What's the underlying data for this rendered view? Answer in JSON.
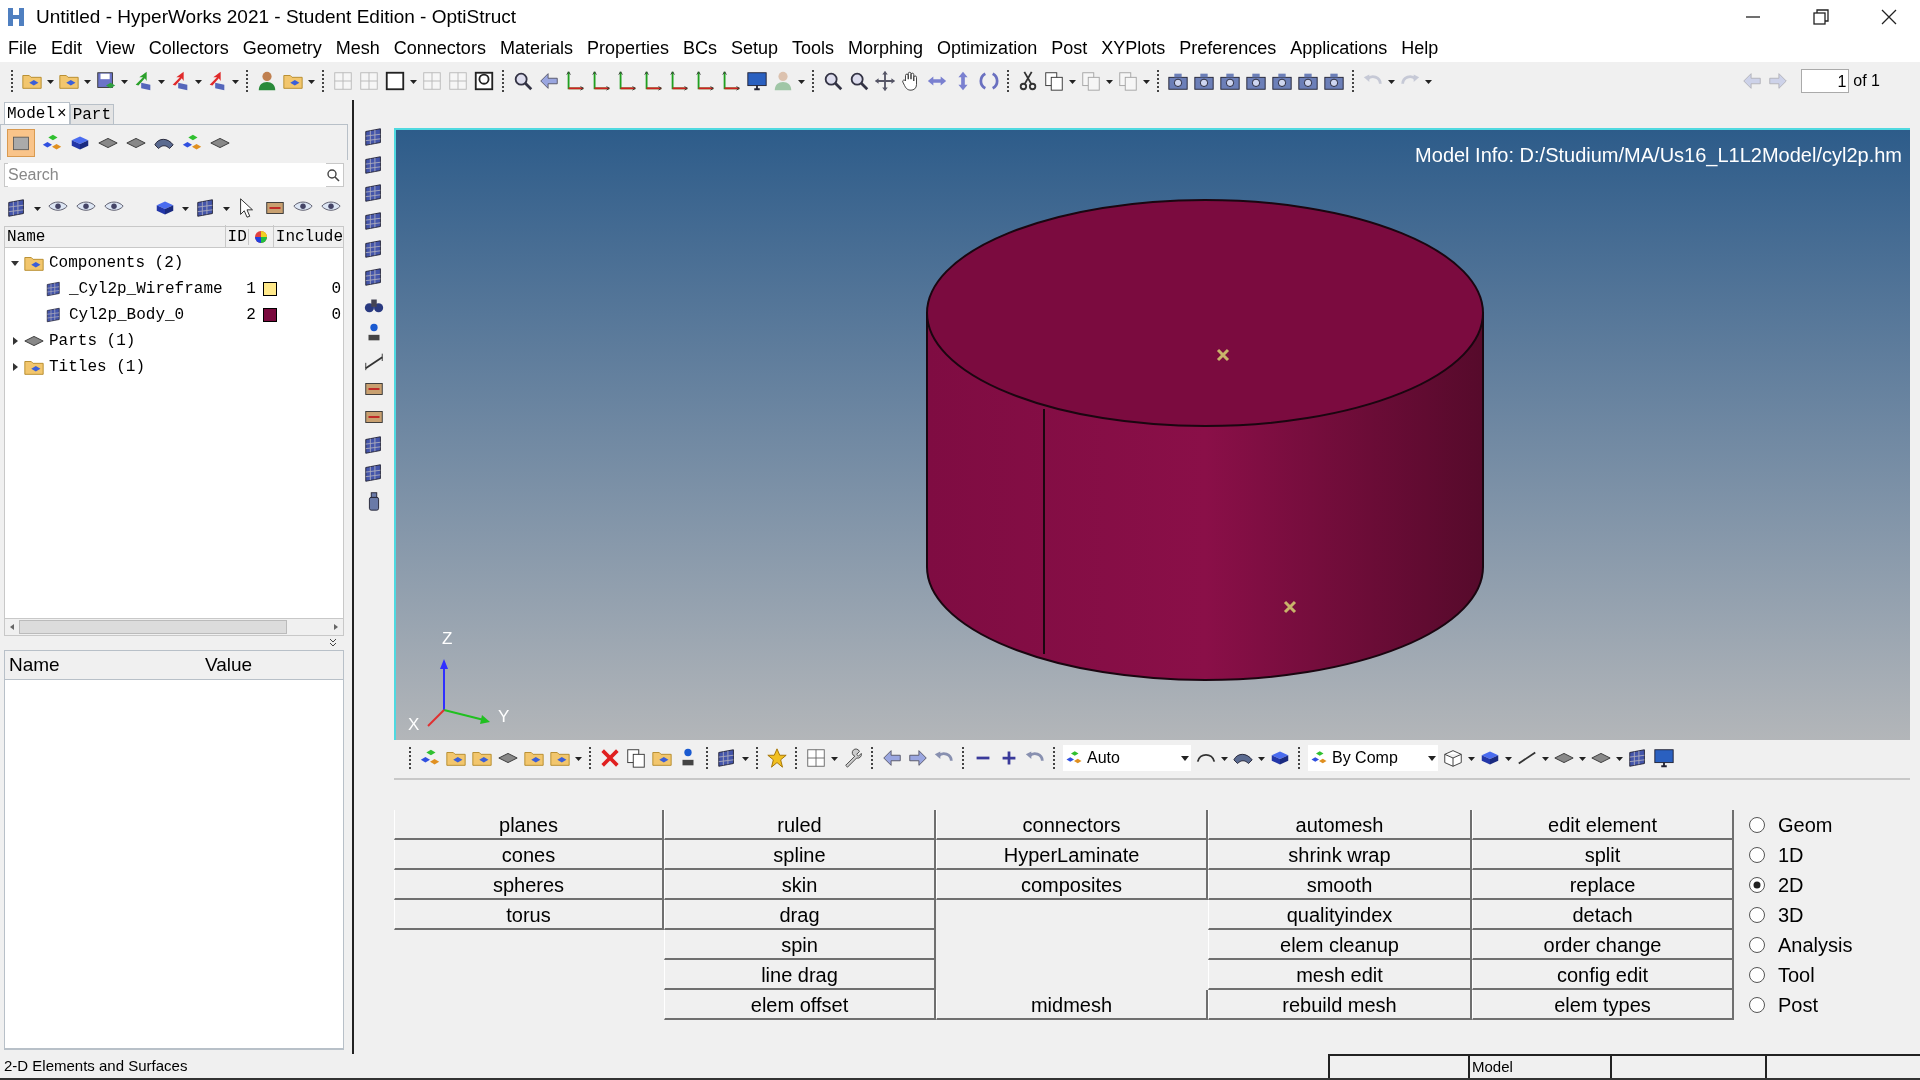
{
  "window": {
    "title": "Untitled - HyperWorks 2021 - Student Edition - OptiStruct"
  },
  "menu": [
    "File",
    "Edit",
    "View",
    "Collectors",
    "Geometry",
    "Mesh",
    "Connectors",
    "Materials",
    "Properties",
    "BCs",
    "Setup",
    "Tools",
    "Morphing",
    "Optimization",
    "Post",
    "XYPlots",
    "Preferences",
    "Applications",
    "Help"
  ],
  "page_nav": {
    "value": "1",
    "suffix": "of 1"
  },
  "browser": {
    "tabs": [
      {
        "label": "Model",
        "selected": true,
        "close": "×"
      },
      {
        "label": "Part",
        "selected": false
      }
    ],
    "search": {
      "placeholder": "Search"
    },
    "columns": [
      "Name",
      "ID",
      "Include"
    ],
    "tree": [
      {
        "label": "Components (2)",
        "expanded": true,
        "children": [
          {
            "label": "_Cyl2p_Wireframe",
            "id": "1",
            "color": "#ffe98a",
            "include": "0"
          },
          {
            "label": "Cyl2p_Body_0",
            "id": "2",
            "color": "#7a0a3e",
            "include": "0"
          }
        ]
      },
      {
        "label": "Parts (1)",
        "expanded": false
      },
      {
        "label": "Titles (1)",
        "expanded": false
      }
    ]
  },
  "properties": {
    "columns": [
      "Name",
      "Value"
    ]
  },
  "viewport": {
    "model_info": "Model Info: D:/Studium/MA/Us16_L1L2Model/cyl2p.hm",
    "axes": {
      "z": "Z",
      "x": "X",
      "y": "Y"
    }
  },
  "view_toolbar": {
    "dropdowns": [
      "Auto",
      "By Comp"
    ]
  },
  "panel": {
    "columns": [
      [
        "planes",
        "cones",
        "spheres",
        "torus",
        null,
        null,
        null
      ],
      [
        "ruled",
        "spline",
        "skin",
        "drag",
        "spin",
        "line drag",
        "elem offset"
      ],
      [
        "connectors",
        "HyperLaminate",
        "composites",
        null,
        null,
        null,
        "midmesh"
      ],
      [
        "automesh",
        "shrink wrap",
        "smooth",
        "qualityindex",
        "elem cleanup",
        "mesh edit",
        "rebuild mesh"
      ],
      [
        "edit element",
        "split",
        "replace",
        "detach",
        "order change",
        "config edit",
        "elem types"
      ]
    ],
    "radios": [
      {
        "label": "Geom",
        "selected": false
      },
      {
        "label": "1D",
        "selected": false
      },
      {
        "label": "2D",
        "selected": true
      },
      {
        "label": "3D",
        "selected": false
      },
      {
        "label": "Analysis",
        "selected": false
      },
      {
        "label": "Tool",
        "selected": false
      },
      {
        "label": "Post",
        "selected": false
      }
    ]
  },
  "status_bar": {
    "message": "2-D Elements and Surfaces",
    "mode": "Model"
  }
}
